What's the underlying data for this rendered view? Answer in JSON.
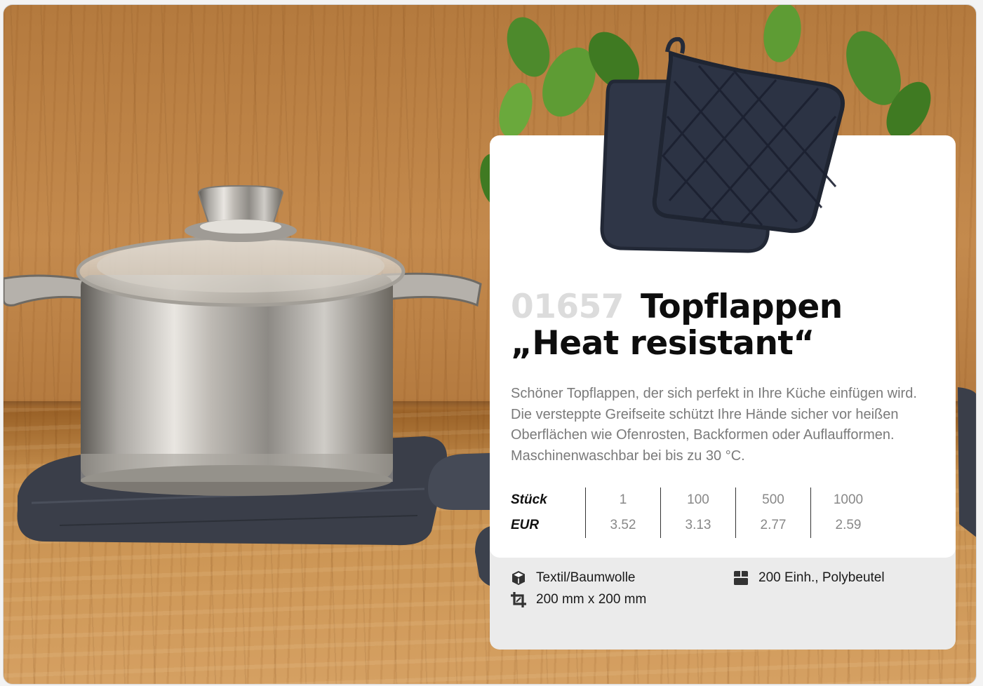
{
  "product": {
    "article_number": "01657",
    "title_line1": "Topflappen",
    "title_line2": "„Heat resistant“",
    "description": "Schöner Topflappen, der sich perfekt in Ihre Küche einfügen wird. Die versteppte Greifseite schützt Ihre Hände sicher vor heißen Oberflächen wie Ofenrosten, Backformen oder Auflauf­formen. Maschinenwaschbar bei bis zu 30 °C."
  },
  "price_table": {
    "quantity_label": "Stück",
    "currency_label": "EUR",
    "quantities": [
      "1",
      "100",
      "500",
      "1000"
    ],
    "prices": [
      "3.52",
      "3.13",
      "2.77",
      "2.59"
    ]
  },
  "specs": {
    "material": "Textil/Baumwolle",
    "size": "200 mm x 200 mm",
    "packaging": "200 Einh., Polybeutel"
  },
  "icons": {
    "material": "cube-icon",
    "size": "crop-icon",
    "packaging": "box-icon"
  },
  "colors": {
    "title": "#0d0d0d",
    "article_number": "#dcdcdc",
    "description": "#7a7a7a",
    "footer_bg": "#ebebeb",
    "potholder": "#2f3647"
  }
}
